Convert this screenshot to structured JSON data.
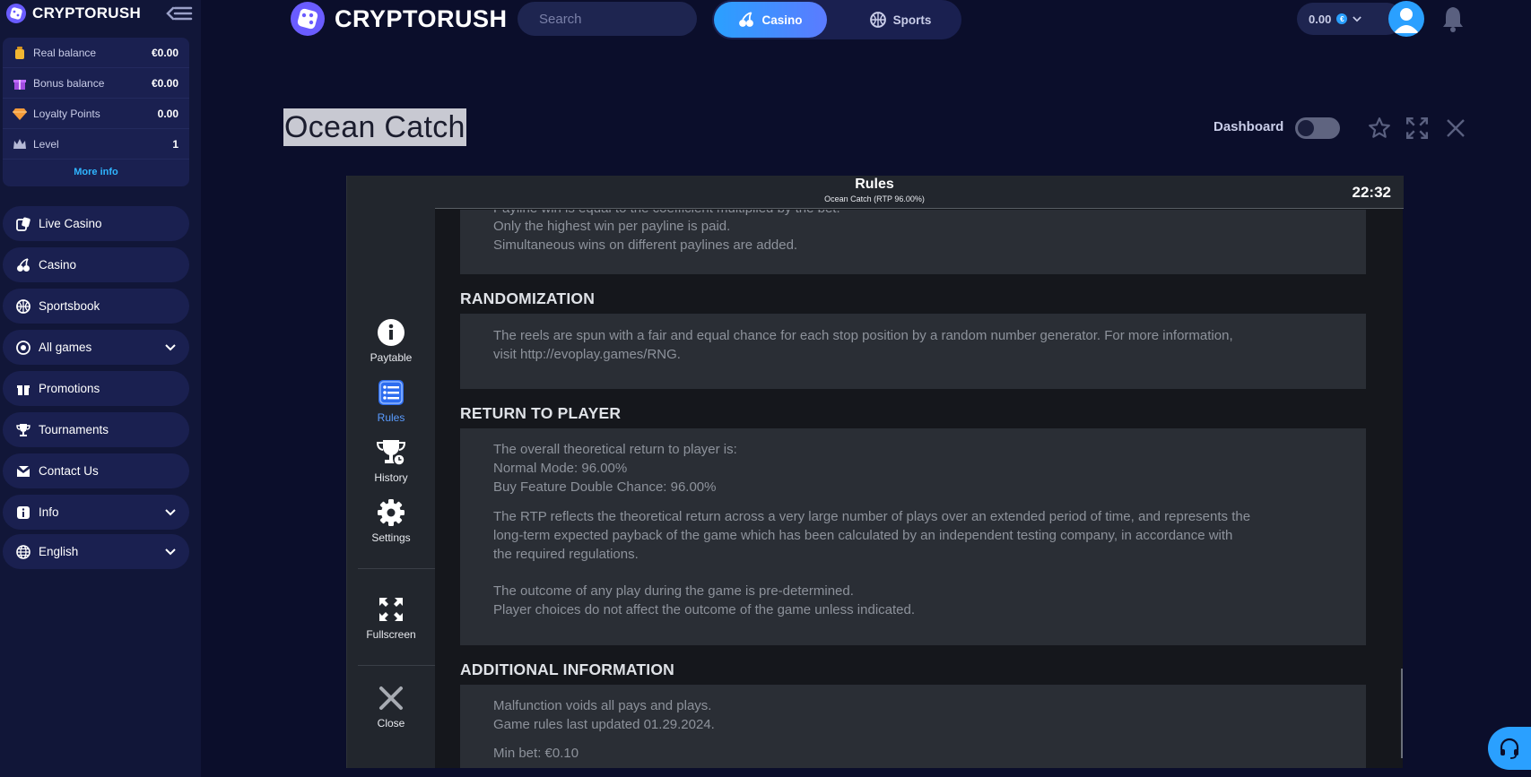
{
  "brand": {
    "name": "CRYPTORUSH"
  },
  "sidebar": {
    "balances": [
      {
        "label": "Real balance",
        "value": "€0.00",
        "icon": "money-bag-icon"
      },
      {
        "label": "Bonus balance",
        "value": "€0.00",
        "icon": "gift-box-icon"
      },
      {
        "label": "Loyalty Points",
        "value": "0.00",
        "icon": "diamond-icon"
      },
      {
        "label": "Level",
        "value": "1",
        "icon": "crown-icon"
      }
    ],
    "more_info": "More info",
    "nav": [
      {
        "label": "Live Casino",
        "icon": "dice-icon"
      },
      {
        "label": "Casino",
        "icon": "cherry-icon"
      },
      {
        "label": "Sportsbook",
        "icon": "basketball-icon"
      },
      {
        "label": "All games",
        "icon": "grid-icon",
        "expandable": true
      },
      {
        "label": "Promotions",
        "icon": "gift-icon"
      },
      {
        "label": "Tournaments",
        "icon": "trophy-icon"
      },
      {
        "label": "Contact Us",
        "icon": "envelope-icon"
      },
      {
        "label": "Info",
        "icon": "info-icon",
        "expandable": true
      },
      {
        "label": "English",
        "icon": "globe-icon",
        "expandable": true
      }
    ]
  },
  "topbar": {
    "search_placeholder": "Search",
    "modes": [
      "Casino",
      "Sports"
    ],
    "active_mode": "Casino",
    "wallet_amount": "0.00",
    "wallet_currency": "€"
  },
  "game": {
    "title": "Ocean Catch",
    "dashboard_label": "Dashboard",
    "dashboard_on": false
  },
  "game_frame": {
    "menu": [
      {
        "label": "Paytable",
        "icon": "info-circle-icon"
      },
      {
        "label": "Rules",
        "icon": "list-icon",
        "active": true
      },
      {
        "label": "History",
        "icon": "trophy-clock-icon"
      },
      {
        "label": "Settings",
        "icon": "gear-icon"
      },
      {
        "label": "Fullscreen",
        "icon": "expand-icon"
      },
      {
        "label": "Close",
        "icon": "close-icon"
      }
    ],
    "header_title": "Rules",
    "header_subtitle": "Ocean Catch (RTP 96.00%)",
    "clock": "22:32",
    "rules": {
      "top_lines": [
        "Payline win is equal to the coefficient multiplied by the bet.",
        "Only the highest win per payline is paid.",
        "Simultaneous wins on different paylines are added."
      ],
      "randomization_heading": "RANDOMIZATION",
      "randomization_text": [
        "The reels are spun with a fair and equal chance for each stop position by a random number generator. For more information,",
        "visit http://evoplay.games/RNG."
      ],
      "rtp_heading": "RETURN TO PLAYER",
      "rtp_lines": [
        "The overall theoretical return to player is:",
        "Normal Mode: 96.00%",
        "Buy Feature Double Chance: 96.00%"
      ],
      "rtp_paragraph": [
        "The RTP reflects the theoretical return across a very large number of plays over an extended period of time, and represents the",
        "long-term expected payback of the game which has been calculated by an independent testing company, in accordance with",
        "the required regulations."
      ],
      "outcome_lines": [
        "The outcome of any play during the game is pre-determined.",
        "Player choices do not affect the outcome of the game unless indicated."
      ],
      "additional_heading": "ADDITIONAL INFORMATION",
      "additional_lines": [
        "Malfunction voids all pays and plays.",
        "Game rules last updated 01.29.2024."
      ],
      "min_bet": "Min bet: €0.10"
    }
  },
  "colors": {
    "page_bg": "#0b0e2b",
    "sidebar_bg": "#111638",
    "card_bg": "#1a2050",
    "accent": "#2aa0ff",
    "link": "#2fb5ff"
  }
}
